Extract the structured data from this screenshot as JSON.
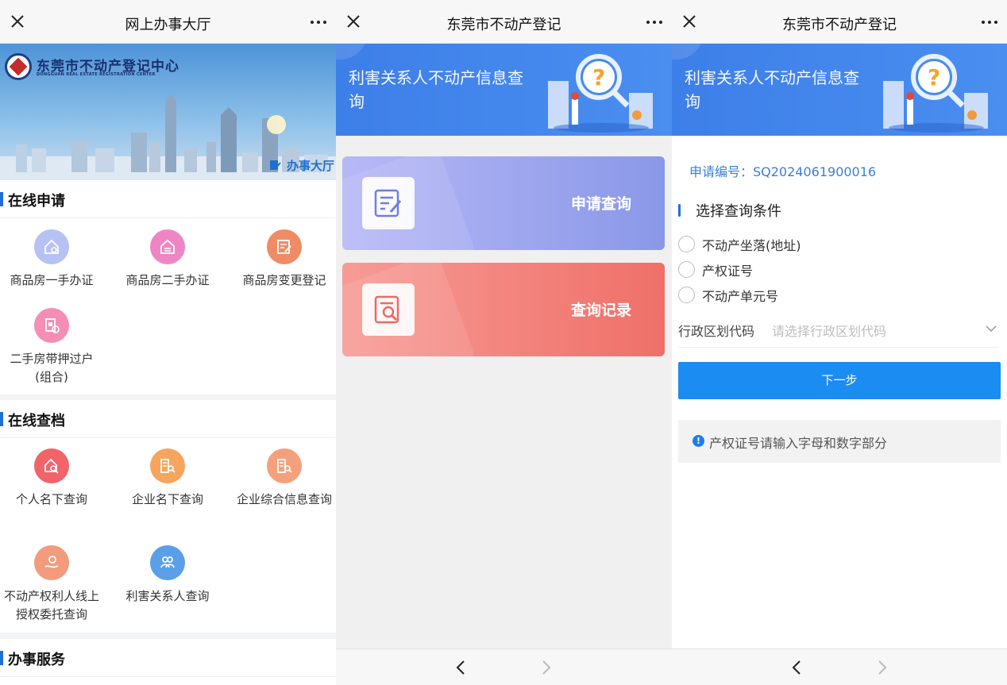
{
  "panel1": {
    "title": "网上办事大厅",
    "logo_text": "东莞市不动产登记中心",
    "logo_sub": "DONGGUAN REAL ESTATE REGISTRATION CENTER",
    "banner_link": "办事大厅",
    "sections": [
      {
        "title": "在线申请",
        "items": [
          {
            "label": "商品房一手办证",
            "icon": "house-certificate-icon",
            "color": "#a9b9f0"
          },
          {
            "label": "商品房二手办证",
            "icon": "house-transfer-icon",
            "color": "#ee86c5"
          },
          {
            "label": "商品房变更登记",
            "icon": "document-edit-icon",
            "color": "#ef8c65"
          },
          {
            "label": "二手房带押过户(组合)",
            "icon": "mortgage-transfer-icon",
            "color": "#f58eb4"
          }
        ]
      },
      {
        "title": "在线查档",
        "items": [
          {
            "label": "个人名下查询",
            "icon": "personal-search-icon",
            "color": "#f0646a"
          },
          {
            "label": "企业名下查询",
            "icon": "company-search-icon",
            "color": "#f5a55e"
          },
          {
            "label": "企业综合信息查询",
            "icon": "company-info-icon",
            "color": "#f5a07c"
          },
          {
            "label": "不动产权利人线上授权委托查询",
            "icon": "authorization-icon",
            "color": "#f29b7d"
          },
          {
            "label": "利害关系人查询",
            "icon": "stakeholder-icon",
            "color": "#5b9fe8"
          }
        ]
      },
      {
        "title": "办事服务",
        "items": []
      }
    ]
  },
  "panel2": {
    "title": "东莞市不动产登记",
    "hero_title": "利害关系人不动产信息查询",
    "cards": [
      {
        "label": "申请查询",
        "icon": "apply-query-icon"
      },
      {
        "label": "查询记录",
        "icon": "query-record-icon"
      }
    ]
  },
  "panel3": {
    "title": "东莞市不动产登记",
    "hero_title": "利害关系人不动产信息查询",
    "application_no": "申请编号：SQ2024061900016",
    "condition_title": "选择查询条件",
    "options": [
      "不动产坐落(地址)",
      "产权证号",
      "不动产单元号"
    ],
    "region_label": "行政区划代码",
    "region_placeholder": "请选择行政区划代码",
    "next_button": "下一步",
    "tip": "产权证号请输入字母和数字部分"
  }
}
